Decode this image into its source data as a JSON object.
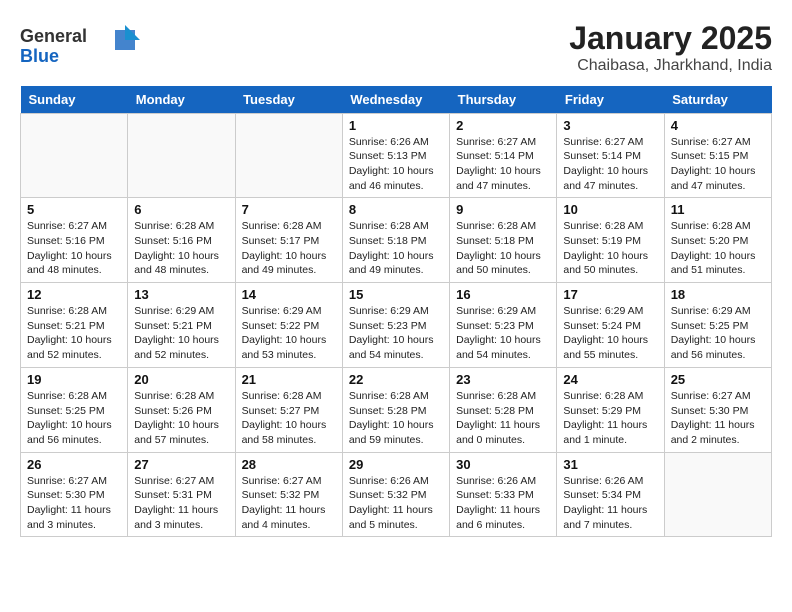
{
  "header": {
    "logo": {
      "line1": "General",
      "line2": "Blue"
    },
    "title": "January 2025",
    "subtitle": "Chaibasa, Jharkhand, India"
  },
  "weekdays": [
    "Sunday",
    "Monday",
    "Tuesday",
    "Wednesday",
    "Thursday",
    "Friday",
    "Saturday"
  ],
  "weeks": [
    [
      {
        "day": "",
        "info": ""
      },
      {
        "day": "",
        "info": ""
      },
      {
        "day": "",
        "info": ""
      },
      {
        "day": "1",
        "info": "Sunrise: 6:26 AM\nSunset: 5:13 PM\nDaylight: 10 hours\nand 46 minutes."
      },
      {
        "day": "2",
        "info": "Sunrise: 6:27 AM\nSunset: 5:14 PM\nDaylight: 10 hours\nand 47 minutes."
      },
      {
        "day": "3",
        "info": "Sunrise: 6:27 AM\nSunset: 5:14 PM\nDaylight: 10 hours\nand 47 minutes."
      },
      {
        "day": "4",
        "info": "Sunrise: 6:27 AM\nSunset: 5:15 PM\nDaylight: 10 hours\nand 47 minutes."
      }
    ],
    [
      {
        "day": "5",
        "info": "Sunrise: 6:27 AM\nSunset: 5:16 PM\nDaylight: 10 hours\nand 48 minutes."
      },
      {
        "day": "6",
        "info": "Sunrise: 6:28 AM\nSunset: 5:16 PM\nDaylight: 10 hours\nand 48 minutes."
      },
      {
        "day": "7",
        "info": "Sunrise: 6:28 AM\nSunset: 5:17 PM\nDaylight: 10 hours\nand 49 minutes."
      },
      {
        "day": "8",
        "info": "Sunrise: 6:28 AM\nSunset: 5:18 PM\nDaylight: 10 hours\nand 49 minutes."
      },
      {
        "day": "9",
        "info": "Sunrise: 6:28 AM\nSunset: 5:18 PM\nDaylight: 10 hours\nand 50 minutes."
      },
      {
        "day": "10",
        "info": "Sunrise: 6:28 AM\nSunset: 5:19 PM\nDaylight: 10 hours\nand 50 minutes."
      },
      {
        "day": "11",
        "info": "Sunrise: 6:28 AM\nSunset: 5:20 PM\nDaylight: 10 hours\nand 51 minutes."
      }
    ],
    [
      {
        "day": "12",
        "info": "Sunrise: 6:28 AM\nSunset: 5:21 PM\nDaylight: 10 hours\nand 52 minutes."
      },
      {
        "day": "13",
        "info": "Sunrise: 6:29 AM\nSunset: 5:21 PM\nDaylight: 10 hours\nand 52 minutes."
      },
      {
        "day": "14",
        "info": "Sunrise: 6:29 AM\nSunset: 5:22 PM\nDaylight: 10 hours\nand 53 minutes."
      },
      {
        "day": "15",
        "info": "Sunrise: 6:29 AM\nSunset: 5:23 PM\nDaylight: 10 hours\nand 54 minutes."
      },
      {
        "day": "16",
        "info": "Sunrise: 6:29 AM\nSunset: 5:23 PM\nDaylight: 10 hours\nand 54 minutes."
      },
      {
        "day": "17",
        "info": "Sunrise: 6:29 AM\nSunset: 5:24 PM\nDaylight: 10 hours\nand 55 minutes."
      },
      {
        "day": "18",
        "info": "Sunrise: 6:29 AM\nSunset: 5:25 PM\nDaylight: 10 hours\nand 56 minutes."
      }
    ],
    [
      {
        "day": "19",
        "info": "Sunrise: 6:28 AM\nSunset: 5:25 PM\nDaylight: 10 hours\nand 56 minutes."
      },
      {
        "day": "20",
        "info": "Sunrise: 6:28 AM\nSunset: 5:26 PM\nDaylight: 10 hours\nand 57 minutes."
      },
      {
        "day": "21",
        "info": "Sunrise: 6:28 AM\nSunset: 5:27 PM\nDaylight: 10 hours\nand 58 minutes."
      },
      {
        "day": "22",
        "info": "Sunrise: 6:28 AM\nSunset: 5:28 PM\nDaylight: 10 hours\nand 59 minutes."
      },
      {
        "day": "23",
        "info": "Sunrise: 6:28 AM\nSunset: 5:28 PM\nDaylight: 11 hours\nand 0 minutes."
      },
      {
        "day": "24",
        "info": "Sunrise: 6:28 AM\nSunset: 5:29 PM\nDaylight: 11 hours\nand 1 minute."
      },
      {
        "day": "25",
        "info": "Sunrise: 6:27 AM\nSunset: 5:30 PM\nDaylight: 11 hours\nand 2 minutes."
      }
    ],
    [
      {
        "day": "26",
        "info": "Sunrise: 6:27 AM\nSunset: 5:30 PM\nDaylight: 11 hours\nand 3 minutes."
      },
      {
        "day": "27",
        "info": "Sunrise: 6:27 AM\nSunset: 5:31 PM\nDaylight: 11 hours\nand 3 minutes."
      },
      {
        "day": "28",
        "info": "Sunrise: 6:27 AM\nSunset: 5:32 PM\nDaylight: 11 hours\nand 4 minutes."
      },
      {
        "day": "29",
        "info": "Sunrise: 6:26 AM\nSunset: 5:32 PM\nDaylight: 11 hours\nand 5 minutes."
      },
      {
        "day": "30",
        "info": "Sunrise: 6:26 AM\nSunset: 5:33 PM\nDaylight: 11 hours\nand 6 minutes."
      },
      {
        "day": "31",
        "info": "Sunrise: 6:26 AM\nSunset: 5:34 PM\nDaylight: 11 hours\nand 7 minutes."
      },
      {
        "day": "",
        "info": ""
      }
    ]
  ]
}
